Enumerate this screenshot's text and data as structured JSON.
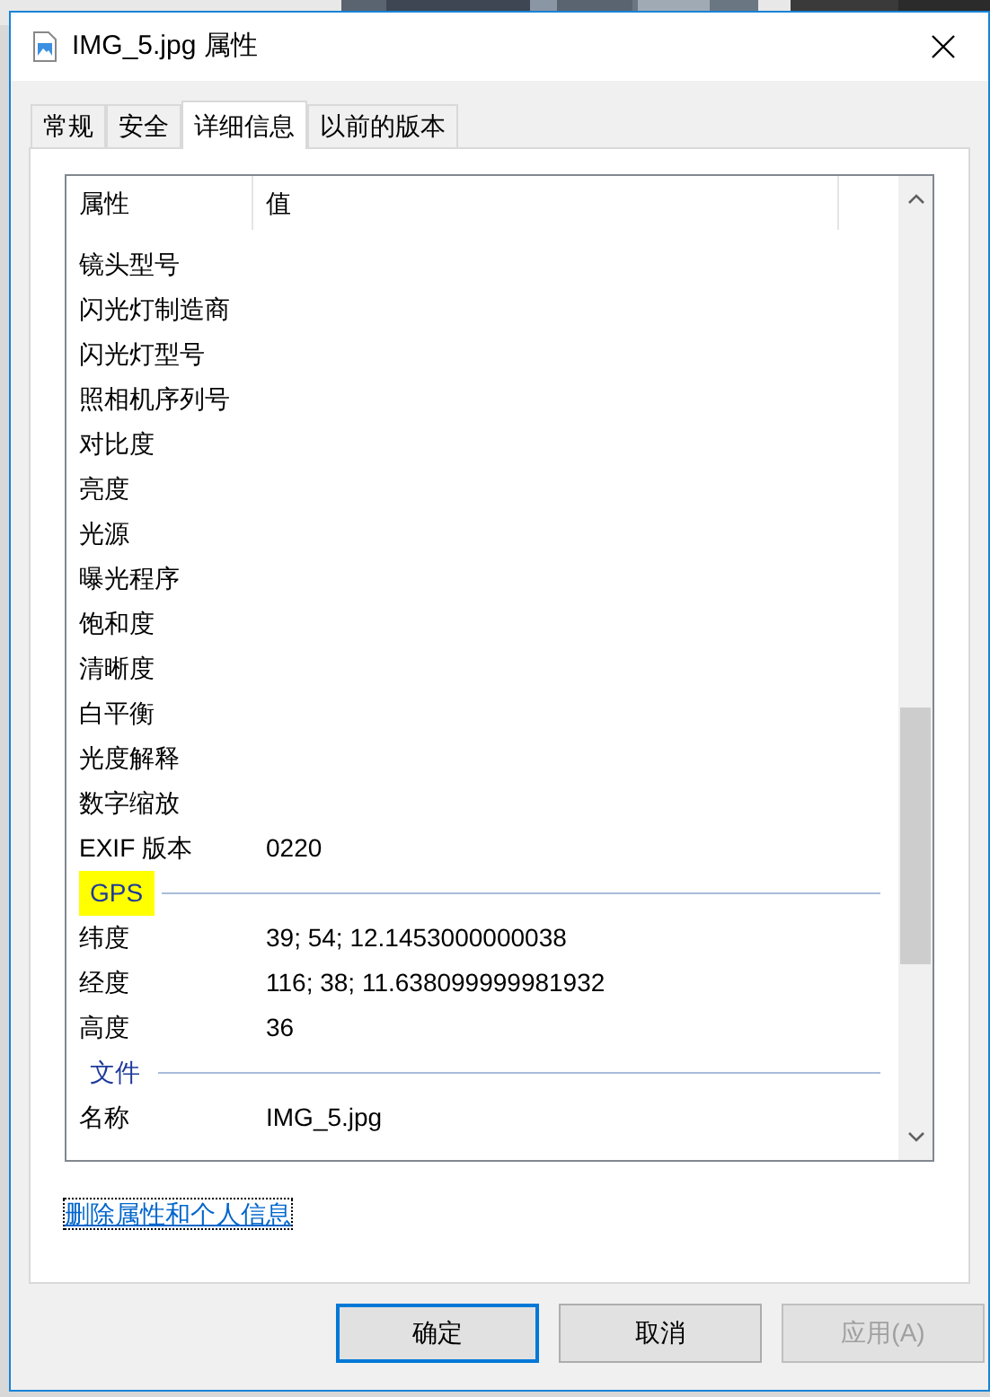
{
  "window": {
    "title": "IMG_5.jpg 属性"
  },
  "tabs": [
    {
      "label": "常规",
      "selected": false
    },
    {
      "label": "安全",
      "selected": false
    },
    {
      "label": "详细信息",
      "selected": true
    },
    {
      "label": "以前的版本",
      "selected": false
    }
  ],
  "table": {
    "columns": [
      "属性",
      "值"
    ],
    "rows": [
      {
        "kind": "row",
        "name": "镜头型号",
        "value": ""
      },
      {
        "kind": "row",
        "name": "闪光灯制造商",
        "value": ""
      },
      {
        "kind": "row",
        "name": "闪光灯型号",
        "value": ""
      },
      {
        "kind": "row",
        "name": "照相机序列号",
        "value": ""
      },
      {
        "kind": "row",
        "name": "对比度",
        "value": ""
      },
      {
        "kind": "row",
        "name": "亮度",
        "value": ""
      },
      {
        "kind": "row",
        "name": "光源",
        "value": ""
      },
      {
        "kind": "row",
        "name": "曝光程序",
        "value": ""
      },
      {
        "kind": "row",
        "name": "饱和度",
        "value": ""
      },
      {
        "kind": "row",
        "name": "清晰度",
        "value": ""
      },
      {
        "kind": "row",
        "name": "白平衡",
        "value": ""
      },
      {
        "kind": "row",
        "name": "光度解释",
        "value": ""
      },
      {
        "kind": "row",
        "name": "数字缩放",
        "value": ""
      },
      {
        "kind": "row",
        "name": "EXIF 版本",
        "value": "0220"
      },
      {
        "kind": "group",
        "name": "GPS",
        "highlighted": true
      },
      {
        "kind": "row",
        "name": "纬度",
        "value": "39; 54; 12.1453000000038"
      },
      {
        "kind": "row",
        "name": "经度",
        "value": "116; 38; 11.638099999981932"
      },
      {
        "kind": "row",
        "name": "高度",
        "value": "36"
      },
      {
        "kind": "group",
        "name": "文件",
        "highlighted": false
      },
      {
        "kind": "row",
        "name": "名称",
        "value": "IMG_5.jpg"
      }
    ]
  },
  "link": "删除属性和个人信息",
  "buttons": [
    {
      "label": "确定",
      "default": true,
      "disabled": false
    },
    {
      "label": "取消",
      "default": false,
      "disabled": false
    },
    {
      "label": "应用(A)",
      "default": false,
      "disabled": true
    }
  ]
}
